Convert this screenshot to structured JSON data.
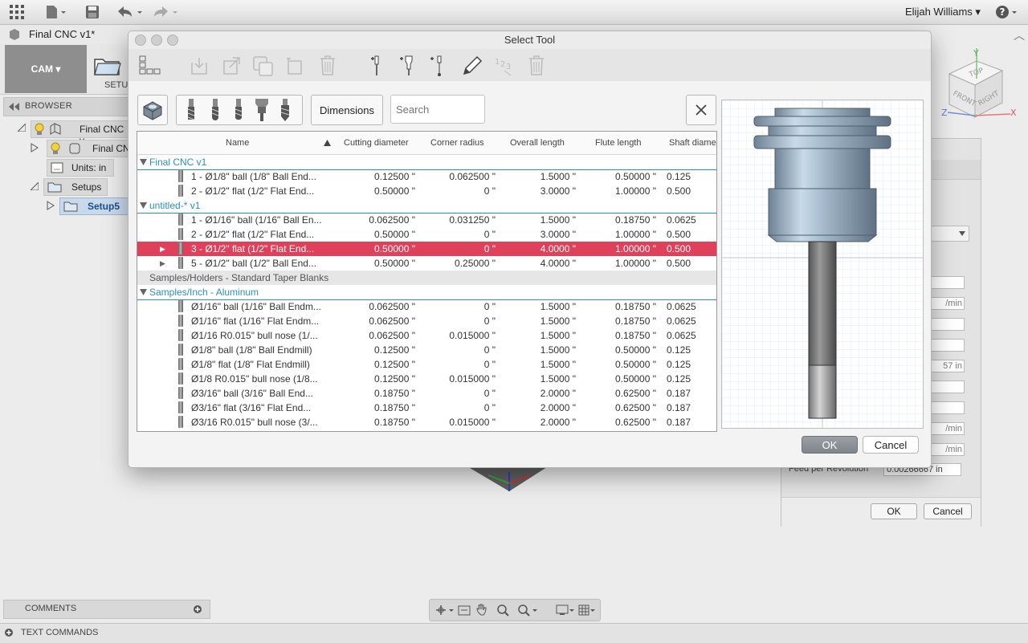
{
  "app": {
    "doc_tab": "Final CNC v1*",
    "user": "Elijah Williams",
    "cam_label": "CAM",
    "setup_label": "SETUP"
  },
  "browser": {
    "title": "BROWSER",
    "items": [
      {
        "label": "Final CNC v"
      },
      {
        "label": "Final CN"
      },
      {
        "label": "Units: in"
      },
      {
        "label": "Setups"
      },
      {
        "label": "Setup5"
      }
    ]
  },
  "right_panel": {
    "fields": [
      "",
      "/min",
      "",
      "",
      "57 in",
      "",
      "",
      "/min",
      "/min"
    ],
    "feed_label": "Feed per Revolution",
    "feed_value": "0.00266667 in",
    "ok": "OK",
    "cancel": "Cancel"
  },
  "bottom": {
    "comments": "COMMENTS",
    "text_commands": "TEXT COMMANDS"
  },
  "viewcube": {
    "top": "TOP",
    "front": "FRONT",
    "right": "RIGHT",
    "x": "X",
    "y": "Y",
    "z": "Z"
  },
  "dialog": {
    "title": "Select Tool",
    "dimensions_btn": "Dimensions",
    "search_placeholder": "Search",
    "ok": "OK",
    "cancel": "Cancel",
    "toolbar_icons": [
      "tree-view-icon",
      "import-icon",
      "export-icon",
      "copy-icon",
      "duplicate-icon",
      "delete-icon",
      "new-mill-tool-icon",
      "new-holder-icon",
      "new-probe-icon",
      "edit-icon",
      "renumber-icon",
      "delete-all-icon"
    ],
    "columns": [
      "Name",
      "Cutting diameter",
      "Corner radius",
      "Overall length",
      "Flute length",
      "Shaft diame"
    ],
    "groups": [
      {
        "name": "Final CNC v1",
        "expanded": true,
        "rows": [
          {
            "name": "1 - Ø1/8\" ball (1/8\" Ball End...",
            "cd": "0.12500 \"",
            "cr": "0.062500 \"",
            "ol": "1.5000 \"",
            "fl": "0.50000 \"",
            "sd": "0.125"
          },
          {
            "name": "2 - Ø1/2\" flat (1/2\" Flat End...",
            "cd": "0.50000 \"",
            "cr": "0 \"",
            "ol": "3.0000 \"",
            "fl": "1.00000 \"",
            "sd": "0.500"
          }
        ]
      },
      {
        "name": "untitled-* v1",
        "expanded": true,
        "rows": [
          {
            "name": "1 - Ø1/16\" ball (1/16\" Ball En...",
            "cd": "0.062500 \"",
            "cr": "0.031250 \"",
            "ol": "1.5000 \"",
            "fl": "0.18750 \"",
            "sd": "0.0625"
          },
          {
            "name": "2 - Ø1/2\" flat (1/2\" Flat End...",
            "cd": "0.50000 \"",
            "cr": "0 \"",
            "ol": "3.0000 \"",
            "fl": "1.00000 \"",
            "sd": "0.500"
          },
          {
            "name": "3 - Ø1/2\" flat (1/2\" Flat End...",
            "cd": "0.50000 \"",
            "cr": "0 \"",
            "ol": "4.0000 \"",
            "fl": "1.00000 \"",
            "sd": "0.500",
            "selected": true,
            "expand": true
          },
          {
            "name": "5 - Ø1/2\" ball (1/2\" Ball End...",
            "cd": "0.50000 \"",
            "cr": "0.25000 \"",
            "ol": "4.0000 \"",
            "fl": "1.00000 \"",
            "sd": "0.500",
            "expand": true
          }
        ]
      },
      {
        "name": "Samples/Holders - Standard Taper Blanks",
        "expanded": false,
        "rows": []
      },
      {
        "name": "Samples/Inch - Aluminum",
        "expanded": true,
        "rows": [
          {
            "name": "Ø1/16\" ball (1/16\" Ball Endm...",
            "cd": "0.062500 \"",
            "cr": "0 \"",
            "ol": "1.5000 \"",
            "fl": "0.18750 \"",
            "sd": "0.0625"
          },
          {
            "name": "Ø1/16\" flat (1/16\" Flat Endm...",
            "cd": "0.062500 \"",
            "cr": "0 \"",
            "ol": "1.5000 \"",
            "fl": "0.18750 \"",
            "sd": "0.0625"
          },
          {
            "name": "Ø1/16 R0.015\" bull nose (1/...",
            "cd": "0.062500 \"",
            "cr": "0.015000 \"",
            "ol": "1.5000 \"",
            "fl": "0.18750 \"",
            "sd": "0.0625"
          },
          {
            "name": "Ø1/8\" ball (1/8\" Ball Endmill)",
            "cd": "0.12500 \"",
            "cr": "0 \"",
            "ol": "1.5000 \"",
            "fl": "0.50000 \"",
            "sd": "0.125"
          },
          {
            "name": "Ø1/8\" flat (1/8\" Flat Endmill)",
            "cd": "0.12500 \"",
            "cr": "0 \"",
            "ol": "1.5000 \"",
            "fl": "0.50000 \"",
            "sd": "0.125"
          },
          {
            "name": "Ø1/8 R0.015\" bull nose (1/8...",
            "cd": "0.12500 \"",
            "cr": "0.015000 \"",
            "ol": "1.5000 \"",
            "fl": "0.50000 \"",
            "sd": "0.125"
          },
          {
            "name": "Ø3/16\" ball (3/16\" Ball End...",
            "cd": "0.18750 \"",
            "cr": "0 \"",
            "ol": "2.0000 \"",
            "fl": "0.62500 \"",
            "sd": "0.187"
          },
          {
            "name": "Ø3/16\" flat (3/16\" Flat End...",
            "cd": "0.18750 \"",
            "cr": "0 \"",
            "ol": "2.0000 \"",
            "fl": "0.62500 \"",
            "sd": "0.187"
          },
          {
            "name": "Ø3/16 R0.015\" bull nose (3/...",
            "cd": "0.18750 \"",
            "cr": "0.015000 \"",
            "ol": "2.0000 \"",
            "fl": "0.62500 \"",
            "sd": "0.187"
          }
        ]
      }
    ]
  },
  "colors": {
    "selection": "#e0405a",
    "group_text": "#2b8fbd",
    "accent_blue": "#2b8fbd"
  }
}
